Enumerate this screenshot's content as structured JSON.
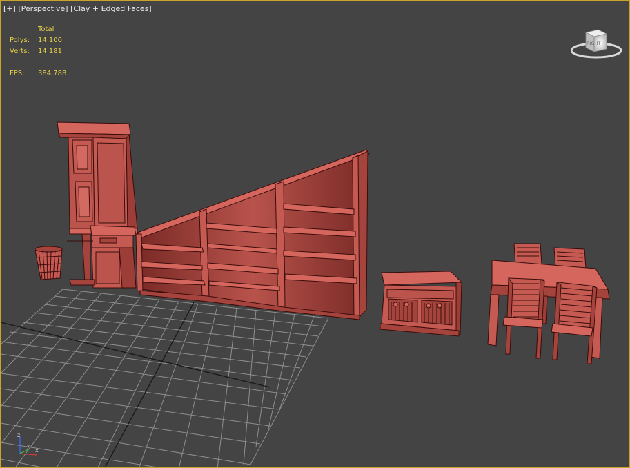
{
  "viewport": {
    "menu_label": "[+]",
    "view_label": "[Perspective]",
    "shading_label": "[Clay + Edged Faces]"
  },
  "stats": {
    "header": "Total",
    "polys_label": "Polys:",
    "polys_value": "14 100",
    "verts_label": "Verts:",
    "verts_value": "14 181",
    "fps_label": "FPS:",
    "fps_value": "384,788"
  },
  "viewcube": {
    "face_label": "RIGHT"
  },
  "axis_gizmo": {
    "labels": [
      "x",
      "y",
      "z"
    ]
  },
  "colors": {
    "background": "#444444",
    "border": "#c9a32a",
    "clay": "#c55a52",
    "edge": "#3a0d0b",
    "grid": "#8a8a8a",
    "stats_text": "#e6d24a"
  },
  "objects": [
    {
      "name": "wastebasket",
      "icon": "basket"
    },
    {
      "name": "tall-cabinet",
      "icon": "cabinet"
    },
    {
      "name": "attic-bookshelf",
      "icon": "bookshelf"
    },
    {
      "name": "sideboard",
      "icon": "sideboard"
    },
    {
      "name": "dining-table-with-chairs",
      "icon": "table"
    }
  ]
}
